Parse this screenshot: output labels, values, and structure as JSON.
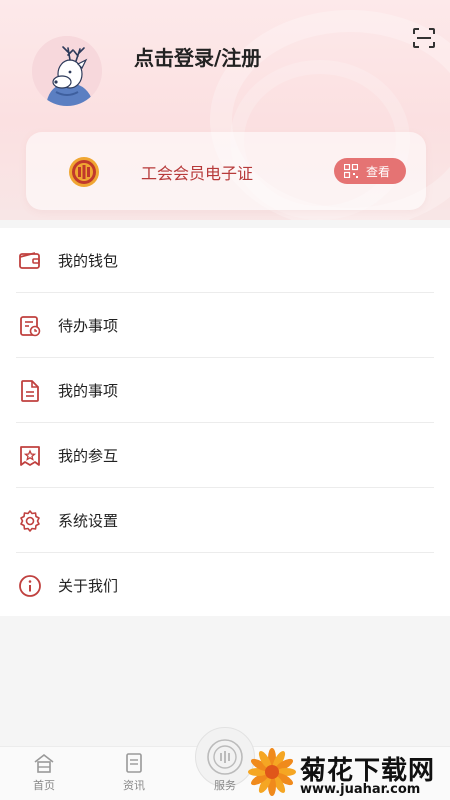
{
  "header": {
    "login_text": "点击登录/注册",
    "card": {
      "title": "工会会员电子证",
      "view_label": "查看"
    }
  },
  "menu": {
    "items": [
      {
        "label": "我的钱包",
        "icon": "wallet-icon"
      },
      {
        "label": "待办事项",
        "icon": "todo-icon"
      },
      {
        "label": "我的事项",
        "icon": "document-icon"
      },
      {
        "label": "我的参互",
        "icon": "star-ticket-icon"
      },
      {
        "label": "系统设置",
        "icon": "gear-icon"
      },
      {
        "label": "关于我们",
        "icon": "info-icon"
      }
    ]
  },
  "bottom_nav": {
    "items": [
      {
        "label": "首页",
        "icon": "home-icon"
      },
      {
        "label": "资讯",
        "icon": "news-icon"
      },
      {
        "label": "服务",
        "icon": "service-icon"
      }
    ]
  },
  "watermark": {
    "title": "菊花下载网",
    "url": "www.juahar.com"
  },
  "colors": {
    "accent": "#c0413f",
    "view_button": "#e57373",
    "header_bg": "#fbe0e1"
  }
}
